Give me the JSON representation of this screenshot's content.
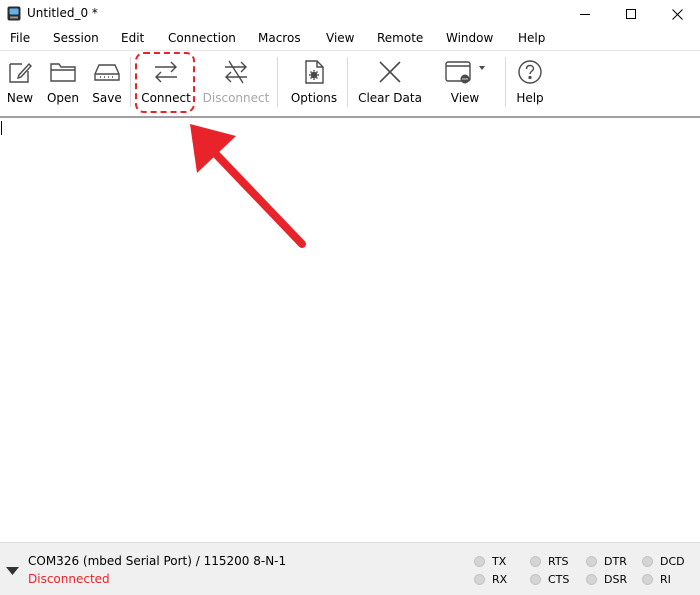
{
  "window": {
    "title": "Untitled_0 *"
  },
  "menu": [
    "File",
    "Session",
    "Edit",
    "Connection",
    "Macros",
    "View",
    "Remote",
    "Window",
    "Help"
  ],
  "toolbar": {
    "new": "New",
    "open": "Open",
    "save": "Save",
    "connect": "Connect",
    "disconnect": "Disconnect",
    "options": "Options",
    "clear_data": "Clear Data",
    "view": "View",
    "help": "Help"
  },
  "status": {
    "port": "COM326 (mbed Serial Port) / 115200 8-N-1",
    "state": "Disconnected",
    "state_color": "#e8232a",
    "signals": [
      "TX",
      "RX",
      "RTS",
      "CTS",
      "DTR",
      "DSR",
      "DCD",
      "RI"
    ]
  },
  "annotation": {
    "color": "#e8232a"
  }
}
